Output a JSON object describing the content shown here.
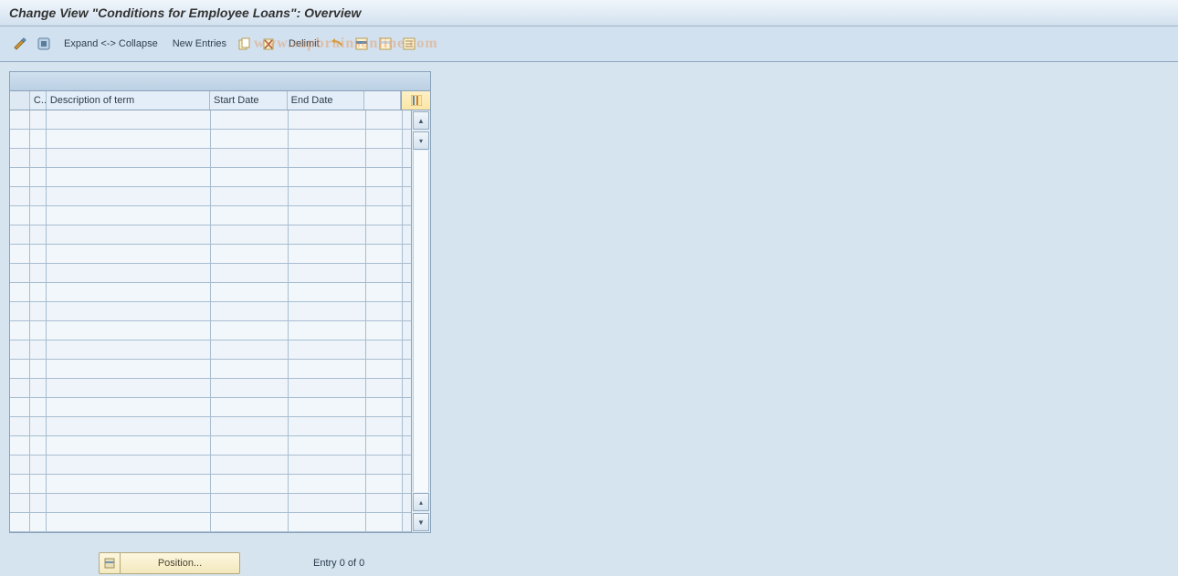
{
  "header": {
    "title": "Change View \"Conditions for Employee Loans\": Overview"
  },
  "toolbar": {
    "expand_collapse": "Expand <-> Collapse",
    "new_entries": "New Entries",
    "delimit": "Delimit"
  },
  "table": {
    "columns": {
      "c": "C..",
      "desc": "Description of term",
      "start": "Start Date",
      "end": "End Date"
    },
    "row_count": 22
  },
  "footer": {
    "position": "Position...",
    "entry": "Entry 0 of 0"
  },
  "watermark": "www.sapbrainsonline.com"
}
